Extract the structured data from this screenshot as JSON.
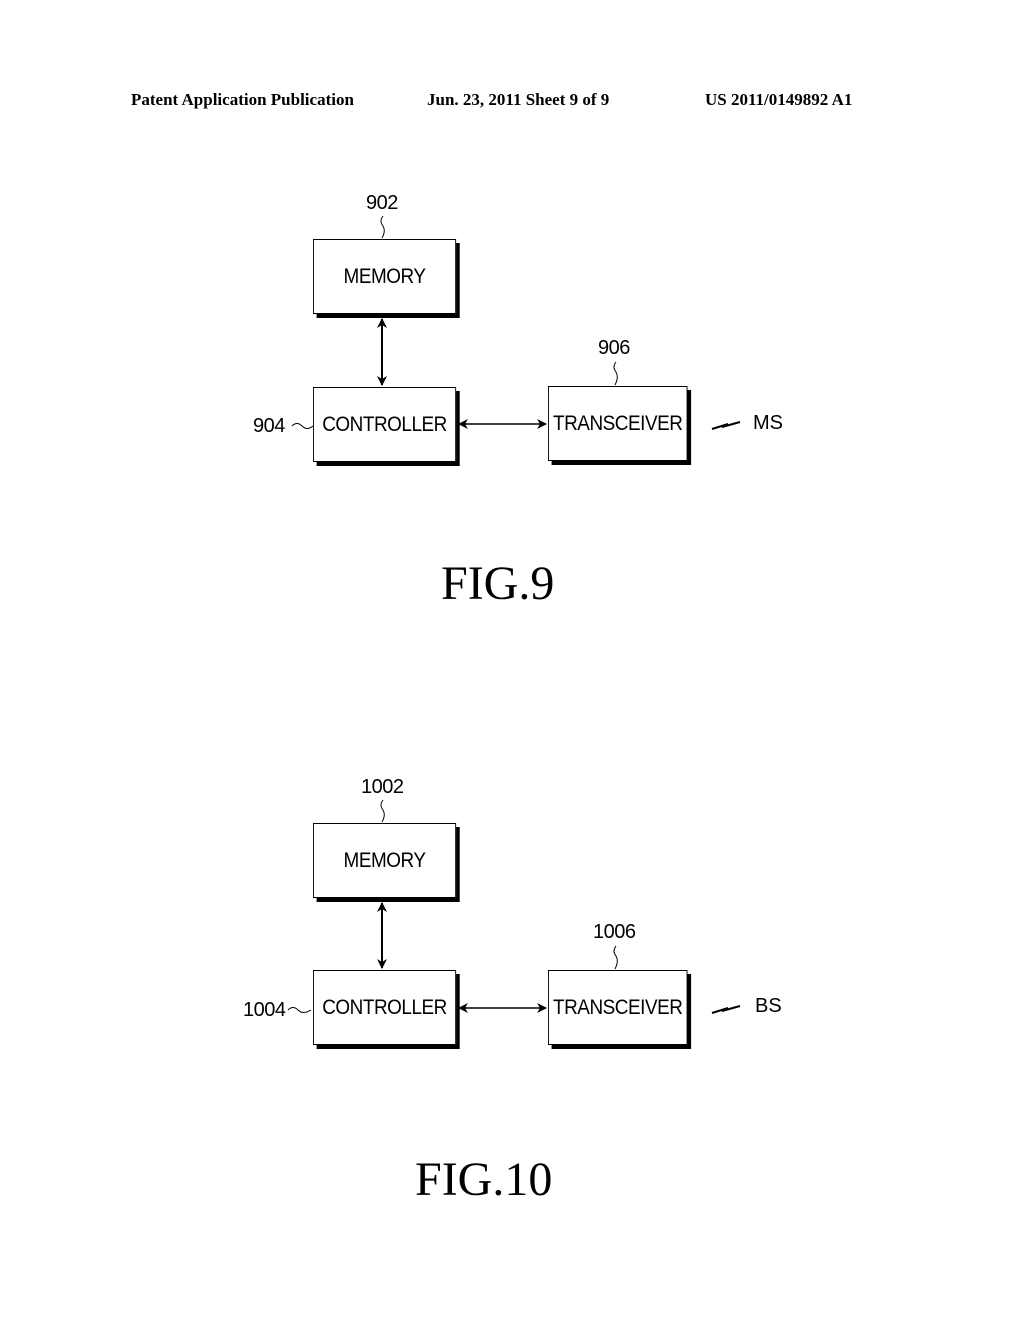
{
  "header": {
    "publication": "Patent Application Publication",
    "date_sheet": "Jun. 23, 2011  Sheet 9 of 9",
    "number": "US 2011/0149892 A1"
  },
  "figures": [
    {
      "caption": "FIG.9",
      "memory": {
        "label": "MEMORY",
        "ref": "902"
      },
      "controller": {
        "label": "CONTROLLER",
        "ref": "904"
      },
      "transceiver": {
        "label": "TRANSCEIVER",
        "ref": "906"
      },
      "wireless_target": "MS"
    },
    {
      "caption": "FIG.10",
      "memory": {
        "label": "MEMORY",
        "ref": "1002"
      },
      "controller": {
        "label": "CONTROLLER",
        "ref": "1004"
      },
      "transceiver": {
        "label": "TRANSCEIVER",
        "ref": "1006"
      },
      "wireless_target": "BS"
    }
  ]
}
